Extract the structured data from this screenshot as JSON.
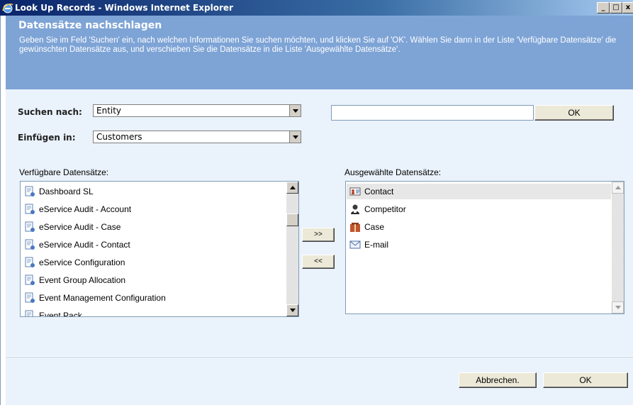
{
  "window": {
    "title": "Look Up Records - Windows Internet Explorer",
    "controls": [
      "_",
      "□",
      "x"
    ]
  },
  "header": {
    "title": "Datensätze nachschlagen",
    "description": "Geben Sie im Feld 'Suchen' ein, nach welchen Informationen Sie suchen möchten, und klicken Sie auf 'OK'. Wählen Sie dann in der Liste 'Verfügbare Datensätze' die gewünschten Datensätze aus, und verschieben Sie die Datensätze in die Liste 'Ausgewählte Datensätze'."
  },
  "search": {
    "search_by_label": "Suchen nach:",
    "search_by_value": "Entity",
    "insert_in_label": "Einfügen in:",
    "insert_in_value": "Customers",
    "search_text": "",
    "ok_label": "OK"
  },
  "available": {
    "label": "Verfügbare Datensätze:",
    "items": [
      {
        "label": "Dashboard SL",
        "icon": "entity-icon"
      },
      {
        "label": "eService Audit - Account",
        "icon": "entity-icon"
      },
      {
        "label": "eService Audit - Case",
        "icon": "entity-icon"
      },
      {
        "label": "eService Audit - Contact",
        "icon": "entity-icon"
      },
      {
        "label": "eService Configuration",
        "icon": "entity-icon"
      },
      {
        "label": "Event Group Allocation",
        "icon": "entity-icon"
      },
      {
        "label": "Event Management Configuration",
        "icon": "entity-icon"
      },
      {
        "label": "Event Pack...",
        "icon": "entity-icon"
      }
    ]
  },
  "move": {
    "add_label": ">>",
    "remove_label": "<<"
  },
  "selected": {
    "label": "Ausgewählte Datensätze:",
    "items": [
      {
        "label": "Contact",
        "icon": "contact-card-icon",
        "selected": true
      },
      {
        "label": "Competitor",
        "icon": "competitor-person-icon",
        "selected": false
      },
      {
        "label": "Case",
        "icon": "case-box-icon",
        "selected": false
      },
      {
        "label": "E-mail",
        "icon": "envelope-icon",
        "selected": false
      }
    ]
  },
  "footer": {
    "cancel_label": "Abbrechen.",
    "ok_label": "OK"
  },
  "colors": {
    "header_band": "#7ea4d6",
    "content_bg": "#eaf2fb",
    "title_bar_start": "#0a246a"
  }
}
